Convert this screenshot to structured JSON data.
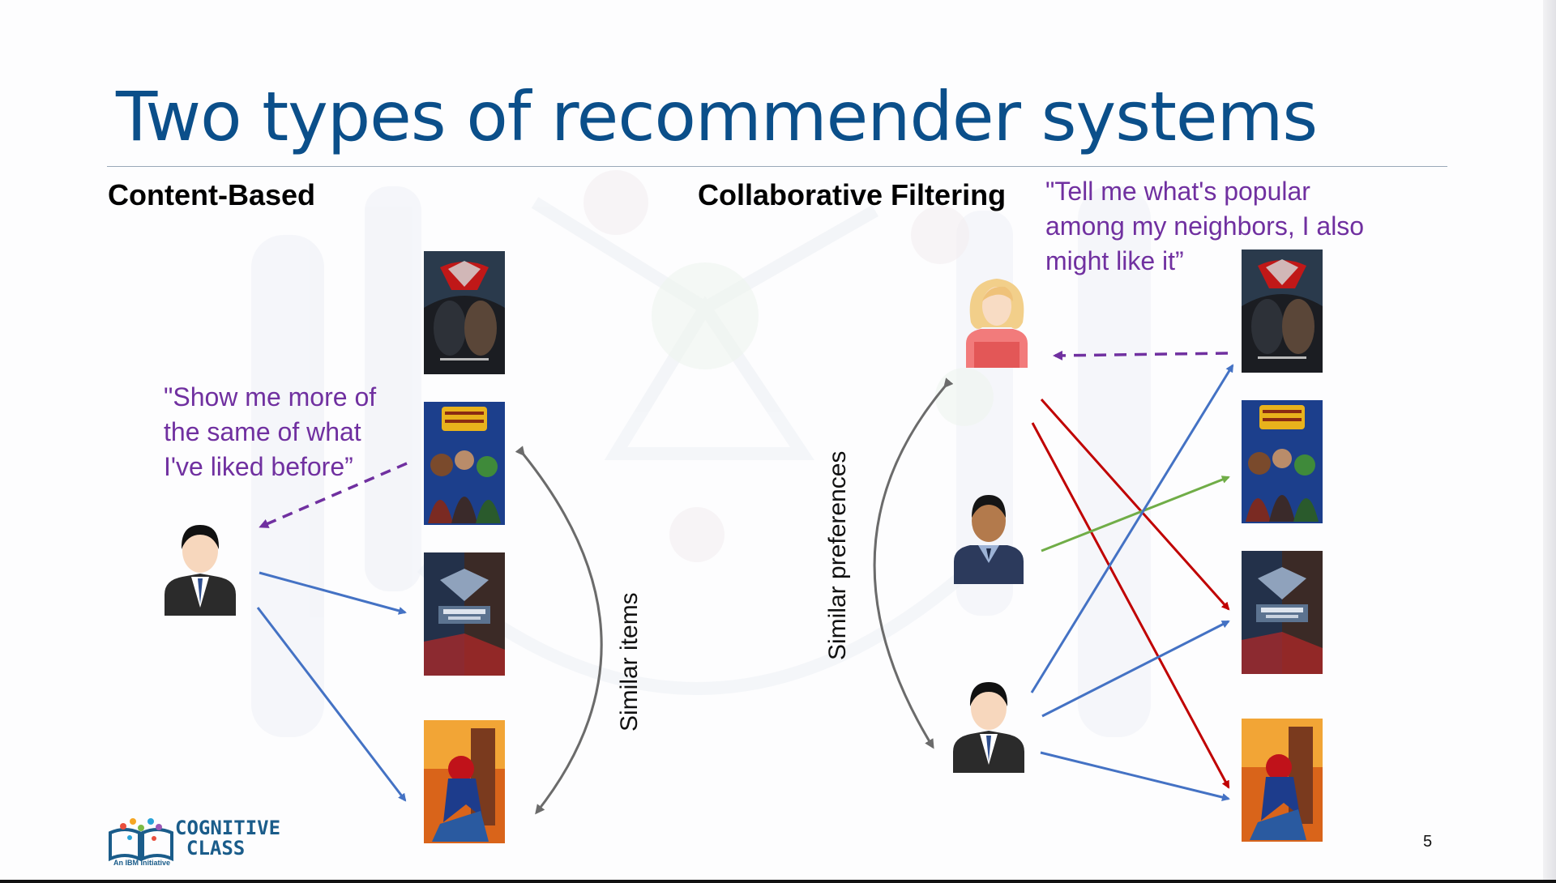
{
  "slide": {
    "title": "Two types of recommender systems",
    "page_number": "5"
  },
  "content_based": {
    "heading": "Content-Based",
    "quote_lines": [
      "\"Show me more of",
      "the same of what",
      "I've liked before”"
    ],
    "curve_label": "Similar items",
    "posters": [
      "batman-v-superman",
      "guardians-of-the-galaxy",
      "captain-america-civil-war",
      "spider-man"
    ]
  },
  "collaborative": {
    "heading": "Collaborative Filtering",
    "quote_lines": [
      "\"Tell me what's popular",
      "among my neighbors, I also",
      "might like it”"
    ],
    "curve_label": "Similar preferences",
    "users": [
      "female-user",
      "dark-skinned-user",
      "target-user"
    ],
    "posters": [
      "batman-v-superman",
      "guardians-of-the-galaxy",
      "captain-america-civil-war",
      "spider-man"
    ]
  },
  "logo": {
    "line1": "COGNITIVE",
    "line2": "CLASS",
    "sub": "An IBM Initiative"
  },
  "colors": {
    "title": "#0b4f8a",
    "quote": "#7030a0",
    "liked_arrow": "#4472c4",
    "recommend_arrow": "#c00000",
    "neighbor_arrow": "#70ad47",
    "curve": "#6b6b6b"
  }
}
